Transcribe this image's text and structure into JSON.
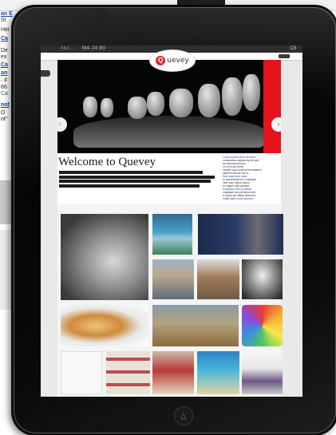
{
  "background_page": {
    "fragments": [
      "an E",
      "St",
      "Hei",
      "Ca",
      "De",
      "ex",
      "Ca",
      "an",
      "- F",
      "66",
      "Ca",
      "not",
      "O",
      "ot\""
    ]
  },
  "status_bar": {
    "carrier": "Ilıı..",
    "time": "MA 24:90",
    "battery": "C8"
  },
  "site": {
    "logo_letter": "Q",
    "logo_text": "uevey",
    "welcome_title": "Welcome to Quevey"
  },
  "hero": {
    "prev_label": "‹",
    "next_label": "›"
  },
  "news": [
    {
      "text": "Lorem ipsum dolor sit amet",
      "kind": "link"
    },
    {
      "text": "consectetur adipiscing elit sed",
      "kind": "dark"
    },
    {
      "text": "do eiusmod tempor",
      "kind": "dark"
    },
    {
      "text": "Ut enim ad minim",
      "kind": "link"
    },
    {
      "text": "veniam quis nostrud exercitation",
      "kind": "dark"
    },
    {
      "text": "ullamco laboris nisi ut",
      "kind": "dark"
    },
    {
      "text": "Duis aute irure dolor",
      "kind": "link"
    },
    {
      "text": "in reprehenderit in voluptate",
      "kind": "dark"
    },
    {
      "text": "velit esse cillum dolore",
      "kind": "dark"
    },
    {
      "text": "eu fugiat nulla pariatur",
      "kind": "dark"
    },
    {
      "text": "Excepteur sint occaecat",
      "kind": "link"
    },
    {
      "text": "cupidatat non proident sunt",
      "kind": "dark"
    },
    {
      "text": "in culpa qui officia deserunt",
      "kind": "dark"
    },
    {
      "text": "mollit anim id est laborum",
      "kind": "link"
    }
  ],
  "home_button_icon": "home-button-icon"
}
